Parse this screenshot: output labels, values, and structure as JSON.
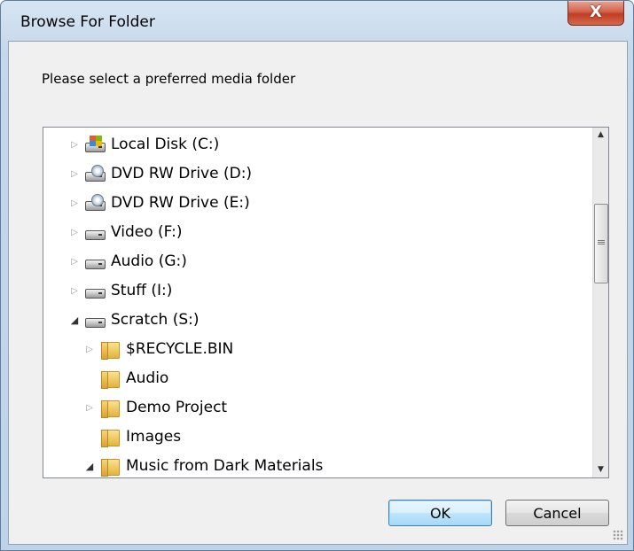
{
  "window": {
    "title": "Browse For Folder",
    "close_label": "X"
  },
  "prompt": "Please select a preferred media folder",
  "tree": {
    "items": [
      {
        "label": "Local Disk (C:)",
        "icon": "windows-drive-icon",
        "expander": "▷"
      },
      {
        "label": "DVD RW Drive (D:)",
        "icon": "dvd-drive-icon",
        "expander": "▷"
      },
      {
        "label": "DVD RW Drive (E:)",
        "icon": "dvd-drive-icon",
        "expander": "▷"
      },
      {
        "label": "Video (F:)",
        "icon": "hard-drive-icon",
        "expander": "▷"
      },
      {
        "label": "Audio (G:)",
        "icon": "hard-drive-icon",
        "expander": "▷"
      },
      {
        "label": "Stuff (I:)",
        "icon": "hard-drive-icon",
        "expander": "▷"
      },
      {
        "label": "Scratch (S:)",
        "icon": "hard-drive-icon",
        "expander": "◢"
      },
      {
        "label": "$RECYCLE.BIN",
        "icon": "folder-icon",
        "expander": "▷"
      },
      {
        "label": "Audio",
        "icon": "folder-icon",
        "expander": ""
      },
      {
        "label": "Demo Project",
        "icon": "folder-icon",
        "expander": "▷"
      },
      {
        "label": "Images",
        "icon": "folder-icon",
        "expander": ""
      },
      {
        "label": "Music from Dark Materials",
        "icon": "folder-icon",
        "expander": "◢"
      }
    ]
  },
  "scrollbar": {
    "up": "▲",
    "down": "▼"
  },
  "buttons": {
    "ok": "OK",
    "cancel": "Cancel"
  }
}
